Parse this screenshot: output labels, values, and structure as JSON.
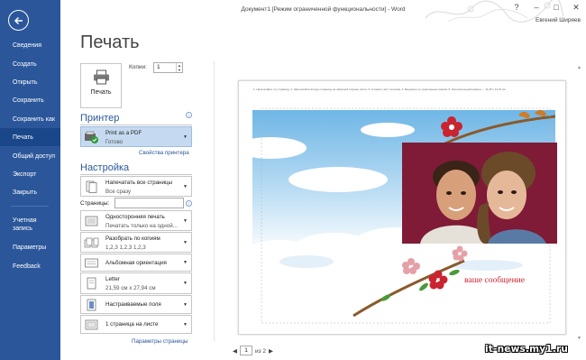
{
  "window": {
    "title": "Документ1 [Режим ограниченной функциональности] - Word",
    "user": "Евгений Ширяев",
    "controls": [
      "?",
      "–",
      "□",
      "✕"
    ]
  },
  "sidebar": {
    "items": [
      {
        "label": "Сведения"
      },
      {
        "label": "Создать"
      },
      {
        "label": "Открыть"
      },
      {
        "label": "Сохранить"
      },
      {
        "label": "Сохранить как"
      },
      {
        "label": "Печать"
      },
      {
        "label": "Общий доступ"
      },
      {
        "label": "Экспорт"
      },
      {
        "label": "Закрыть"
      },
      {
        "label": "Учетная запись"
      },
      {
        "label": "Параметры"
      },
      {
        "label": "Feedback"
      }
    ],
    "active": "Печать",
    "accent": "#2b579a"
  },
  "print": {
    "title": "Печать",
    "print_button": "Печать",
    "copies_label": "Копии:",
    "copies_value": "1",
    "printer_heading": "Принтер",
    "printer_name": "Print as a PDF",
    "printer_status": "Готово",
    "printer_props_link": "Свойства принтера",
    "settings_heading": "Настройка",
    "pages_label": "Страницы:",
    "pages_value": "",
    "page_setup_link": "Параметры страницы",
    "settings": [
      {
        "line1": "Напечатать все страницы",
        "line2": "Все сразу",
        "icon": "pages-icon"
      },
      {
        "line1": "Односторонняя печать",
        "line2": "Печатать только на одной...",
        "icon": "one-sided-icon"
      },
      {
        "line1": "Разобрать по копиям",
        "line2": "1,2,3    1,2,3    1,2,3",
        "icon": "collate-icon"
      },
      {
        "line1": "Альбомная ориентация",
        "line2": "",
        "icon": "orientation-icon"
      },
      {
        "line1": "Letter",
        "line2": "21,59 см x 27,94 см",
        "icon": "paper-size-icon"
      },
      {
        "line1": "Настраиваемые поля",
        "line2": "",
        "icon": "margins-icon"
      },
      {
        "line1": "1 страница на листе",
        "line2": "",
        "icon": "pages-per-sheet-icon"
      }
    ]
  },
  "preview": {
    "guide_text": "1. Напечатайте эту страницу.   2. Напечатайте вторую страницу на обратной стороне листа.   3. Сложите лист пополам.   4. Вырежьте по пунктирным линиям.   5. Окончательный размер — 11,25 x 13,76 см",
    "message": "ваше сообщение",
    "page_current": "1",
    "page_total_text": "из 2",
    "prev_glyph": "◀",
    "next_glyph": "▶"
  },
  "watermark": "it-news.my1.ru"
}
